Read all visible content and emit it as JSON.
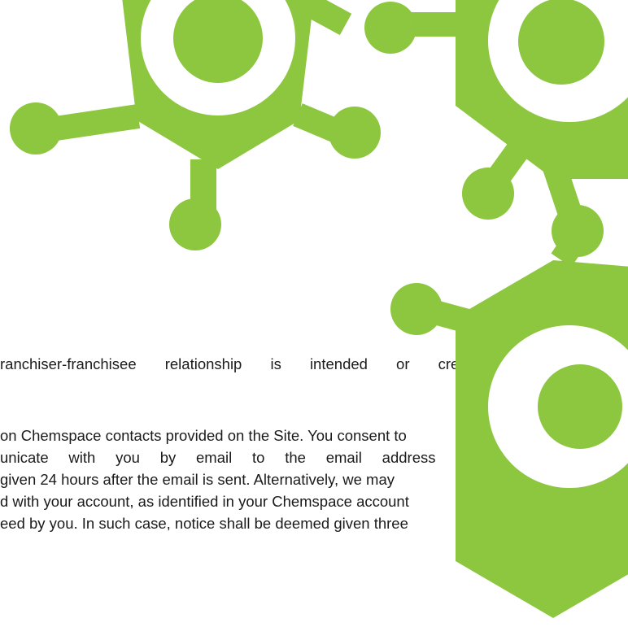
{
  "document": {
    "lines": [
      "ranchiser-franchisee relationship is intended or created by",
      "on Chemspace contacts provided on the Site. You consent to",
      "unicate with you by email to the email address you have",
      "given 24 hours after the email is sent. Alternatively, we may",
      "d with your account, as identified in your Chemspace account",
      "eed by you. In such case, notice shall be deemed given three"
    ]
  },
  "colors": {
    "brand_green": "#8dc63f",
    "text": "#1b1b1b",
    "background": "#ffffff"
  },
  "decoration": {
    "shape": "molecule-hexagon-pattern"
  }
}
